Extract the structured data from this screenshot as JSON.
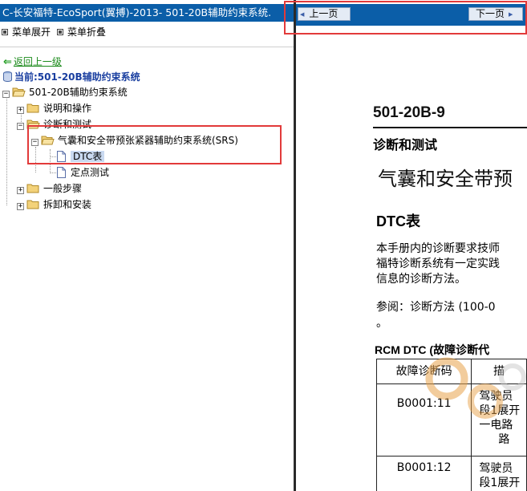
{
  "left": {
    "window_title": "C-长安福特-EcoSport(翼搏)-2013- 501-20B辅助约束系统.",
    "menu": [
      {
        "label": "菜单展开"
      },
      {
        "label": "菜单折叠"
      }
    ],
    "back_link": "返回上一级",
    "current": "当前:501-20B辅助约束系统",
    "tree": {
      "root": "501-20B辅助约束系统",
      "node_description": "说明和操作",
      "node_diagnosis": "诊断和测试",
      "node_srs": "气囊和安全带预张紧器辅助约束系统(SRS)",
      "leaf_dtc": "DTC表",
      "leaf_pinpoint": "定点测试",
      "node_general": "一般步骤",
      "node_removal": "拆卸和安装"
    }
  },
  "right": {
    "nav": {
      "prev_label": "上一页",
      "next_label": "下一页"
    },
    "doc": {
      "page_number": "501-20B-9",
      "section": "诊断和测试",
      "heading": "气囊和安全带预",
      "subheading": "DTC表",
      "para_line1": "本手册内的诊断要求技师",
      "para_line2": "福特诊断系统有一定实践",
      "para_line3": "信息的诊断方法。",
      "ref_line1": "参阅：诊断方法 (100-0",
      "ref_line2": "。",
      "table_title": "RCM DTC (故障诊断代",
      "table": {
        "headers": [
          "故障诊断码",
          "描"
        ],
        "rows": [
          {
            "code": "B0001:11",
            "desc_lines": [
              "驾驶员",
              "段1展开",
              "一电路",
              "路"
            ]
          },
          {
            "code": "B0001:12",
            "desc_lines": [
              "驾驶员",
              "段1展开"
            ]
          }
        ]
      }
    }
  },
  "colors": {
    "title_bar": "#0b5ea8",
    "highlight_box": "#e23a3a",
    "link_green": "#1a8a1a",
    "current_blue": "#1a3fa0",
    "selection": "#c9d9f0"
  }
}
